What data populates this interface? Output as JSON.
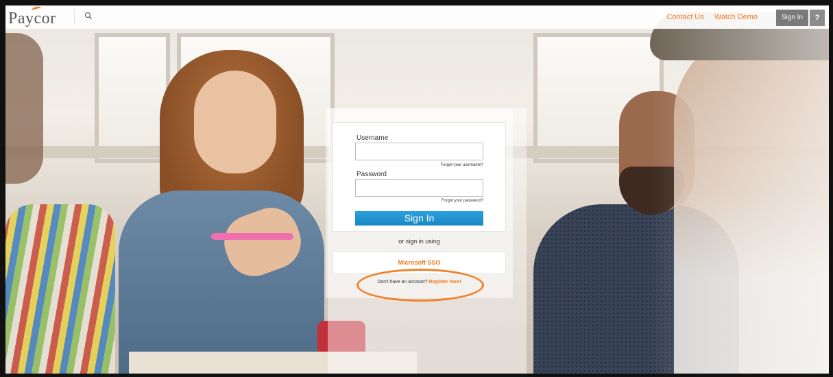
{
  "header": {
    "logo_text": "Paycor",
    "links": [
      {
        "label": "Contact Us"
      },
      {
        "label": "Watch Demo"
      }
    ],
    "signin_label": "Sign In",
    "help_label": "?"
  },
  "login": {
    "username_label": "Username",
    "username_value": "",
    "forgot_username": "Forgot your username?",
    "password_label": "Password",
    "password_value": "",
    "forgot_password": "Forgot your password?",
    "signin_button": "Sign In",
    "or_text": "or sign in using",
    "sso_label": "Microsoft SSO",
    "register_prompt": "Don't have an account?",
    "register_link": "Register here!"
  },
  "colors": {
    "accent": "#f47b20",
    "button_blue": "#1b86c4"
  },
  "icons": {
    "search": "search-icon"
  }
}
